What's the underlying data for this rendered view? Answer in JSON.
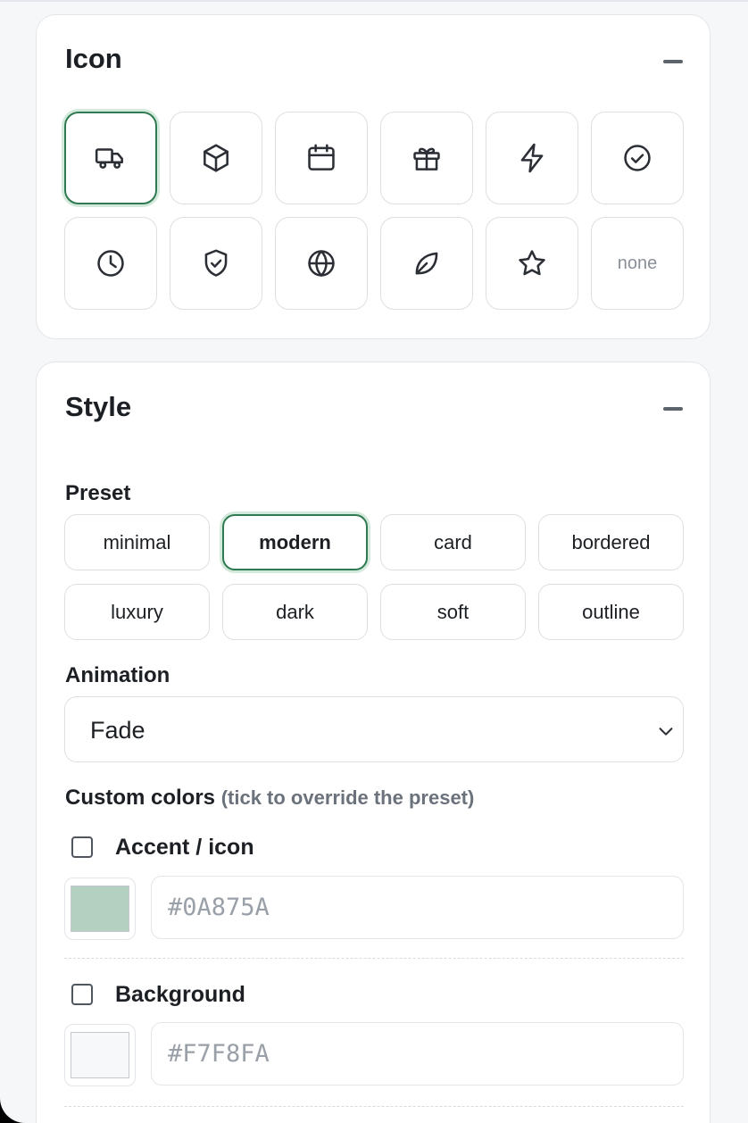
{
  "icon_section": {
    "title": "Icon",
    "icons": [
      {
        "name": "truck-icon",
        "selected": true
      },
      {
        "name": "box-icon",
        "selected": false
      },
      {
        "name": "calendar-icon",
        "selected": false
      },
      {
        "name": "gift-icon",
        "selected": false
      },
      {
        "name": "lightning-icon",
        "selected": false
      },
      {
        "name": "check-circle-icon",
        "selected": false
      },
      {
        "name": "clock-icon",
        "selected": false
      },
      {
        "name": "shield-check-icon",
        "selected": false
      },
      {
        "name": "globe-icon",
        "selected": false
      },
      {
        "name": "leaf-icon",
        "selected": false
      },
      {
        "name": "star-icon",
        "selected": false
      }
    ],
    "none_label": "none"
  },
  "style_section": {
    "title": "Style",
    "preset_label": "Preset",
    "presets": [
      "minimal",
      "modern",
      "card",
      "bordered",
      "luxury",
      "dark",
      "soft",
      "outline"
    ],
    "selected_preset": "modern",
    "animation_label": "Animation",
    "animation_value": "Fade",
    "custom_colors_label": "Custom colors",
    "custom_colors_hint": "(tick to override the preset)",
    "colors": [
      {
        "label": "Accent / icon",
        "placeholder": "#0A875A",
        "swatch": "#b3d0c1",
        "checked": false
      },
      {
        "label": "Background",
        "placeholder": "#F7F8FA",
        "swatch": "#f7f8fa",
        "checked": false
      }
    ]
  },
  "theme": {
    "accent": "#2f7a50",
    "accent_ring": "#d3e9dc"
  }
}
